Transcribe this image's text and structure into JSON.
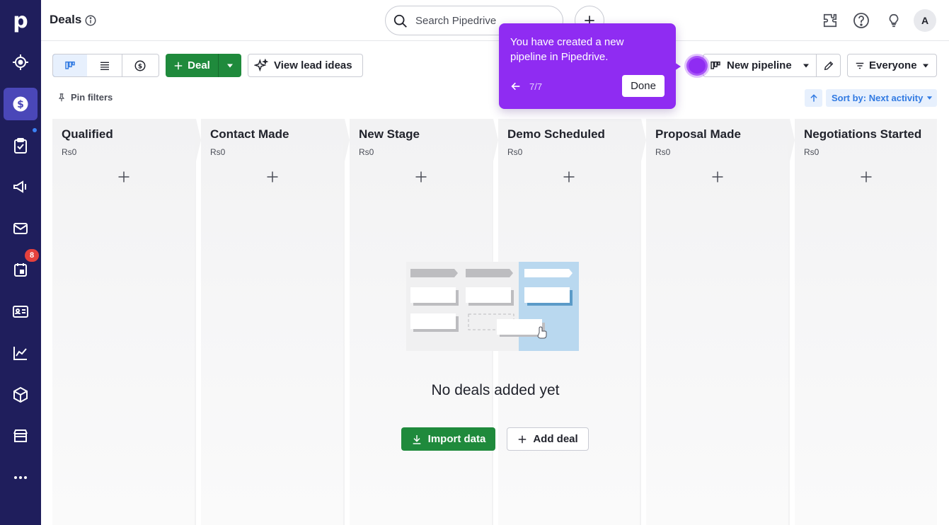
{
  "sidebar": {
    "logo": "p",
    "items": [
      {
        "name": "target-icon"
      },
      {
        "name": "deals-icon",
        "active": true
      },
      {
        "name": "activities-icon"
      },
      {
        "name": "campaigns-icon"
      },
      {
        "name": "mail-icon"
      },
      {
        "name": "calendar-icon",
        "badge": "8"
      },
      {
        "name": "contacts-icon"
      },
      {
        "name": "insights-icon"
      },
      {
        "name": "products-icon"
      },
      {
        "name": "marketplace-icon"
      },
      {
        "name": "more-icon"
      }
    ],
    "calendar_badge": "8"
  },
  "header": {
    "title": "Deals",
    "search_placeholder": "Search Pipedrive",
    "avatar_initial": "A"
  },
  "toolbar": {
    "deal_label": "Deal",
    "lead_ideas_label": "View lead ideas",
    "pipeline_label": "New pipeline",
    "everyone_label": "Everyone",
    "pin_filters_label": "Pin filters",
    "sort_label": "Sort by: Next activity"
  },
  "stages": [
    {
      "name": "Qualified",
      "amount": "Rs0"
    },
    {
      "name": "Contact Made",
      "amount": "Rs0"
    },
    {
      "name": "New Stage",
      "amount": "Rs0"
    },
    {
      "name": "Demo Scheduled",
      "amount": "Rs0"
    },
    {
      "name": "Proposal Made",
      "amount": "Rs0"
    },
    {
      "name": "Negotiations Started",
      "amount": "Rs0"
    }
  ],
  "empty_state": {
    "message": "No deals added yet",
    "import_label": "Import data",
    "add_deal_label": "Add deal"
  },
  "tooltip": {
    "text": "You have created a new pipeline in Pipedrive.",
    "step": "7/7",
    "done_label": "Done"
  },
  "colors": {
    "sidebar_bg": "#1f1e5c",
    "sidebar_active": "#4a47b8",
    "primary_green": "#1f8a3c",
    "accent_blue": "#317ae2",
    "tooltip_purple": "#8f2cf2",
    "badge_red": "#e5413d"
  }
}
